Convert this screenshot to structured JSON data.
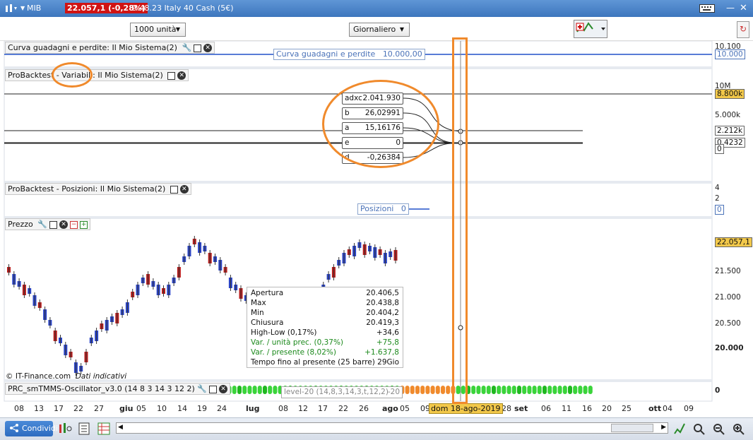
{
  "titlebar": {
    "symbol": "MIB",
    "price_badge": "22.057,1 (-0,28%)",
    "instrument": "9.48.23 Italy 40 Cash (5€)"
  },
  "toolbar": {
    "units": "1000 unità",
    "period": "Giornaliero"
  },
  "equity_panel": {
    "title": "Curva guadagni e perdite: Il Mio Sistema(2)",
    "label": "Curva guadagni e perdite",
    "value": "10.000,00",
    "axis_top": "10.100",
    "axis_box": "10.000"
  },
  "vars_panel": {
    "title_prefix": "ProBacktest - ",
    "title_highlight": "Variabili:",
    "title_suffix": " Il Mio Sistema(2)",
    "axis": [
      "10M",
      "5.000k"
    ],
    "axis_boxes": [
      "8.800k",
      "2.212k",
      "0.4232",
      "0"
    ],
    "variables": [
      {
        "name": "adxc",
        "value": "2.041.930"
      },
      {
        "name": "b",
        "value": "26,02991"
      },
      {
        "name": "a",
        "value": "15,16176"
      },
      {
        "name": "e",
        "value": "0"
      },
      {
        "name": "d",
        "value": "-0,26384"
      }
    ]
  },
  "pos_panel": {
    "title": "ProBacktest - Posizioni: Il Mio Sistema(2)",
    "label": "Posizioni",
    "value": "0",
    "axis": [
      "4",
      "2"
    ],
    "axis_box": "0"
  },
  "price_panel": {
    "title": "Prezzo",
    "axis": [
      "21.500",
      "21.000",
      "20.500",
      "20.000"
    ],
    "last_price": "22.057,1",
    "credit": "© IT-Finance.com",
    "credit_note": "Dati indicativi"
  },
  "ohlc_tooltip": [
    {
      "label": "Apertura",
      "value": "20.406,5",
      "green": false
    },
    {
      "label": "Max",
      "value": "20.438,8",
      "green": false
    },
    {
      "label": "Min",
      "value": "20.404,2",
      "green": false
    },
    {
      "label": "Chiusura",
      "value": "20.419,3",
      "green": false
    },
    {
      "label": "High-Low (0,17%)",
      "value": "+34,6",
      "green": false
    },
    {
      "label": "Var. / unità prec. (0,37%)",
      "value": "+75,8",
      "green": true
    },
    {
      "label": "Var. / presente (8,02%)",
      "value": "+1.637,8",
      "green": true
    },
    {
      "label": "Tempo fino al presente (25 barre)",
      "value": "29Gio",
      "green": false
    }
  ],
  "osc_panel": {
    "title": "PRC_smTMMS-Oscillator_v3.0 (14 8 3 14 3 12 2)",
    "level_label": "level-20 (14,8,3,14,3,t,12,2)",
    "level_value": "-20",
    "axis_zero": "0"
  },
  "x_axis": [
    "08",
    "13",
    "17",
    "22",
    "27",
    "giu",
    "05",
    "10",
    "14",
    "19",
    "24",
    "lug",
    "08",
    "12",
    "17",
    "22",
    "26",
    "ago",
    "05",
    "09",
    "28",
    "set",
    "06",
    "11",
    "16",
    "20",
    "25",
    "ott",
    "04",
    "09"
  ],
  "cursor_date": "dom 18-ago-2019",
  "bottom": {
    "share_label": "Condividi"
  },
  "colors": {
    "accent": "#f08a2c",
    "bull": "#2b45c8",
    "bear": "#b81d1d",
    "badge": "#d01313"
  }
}
